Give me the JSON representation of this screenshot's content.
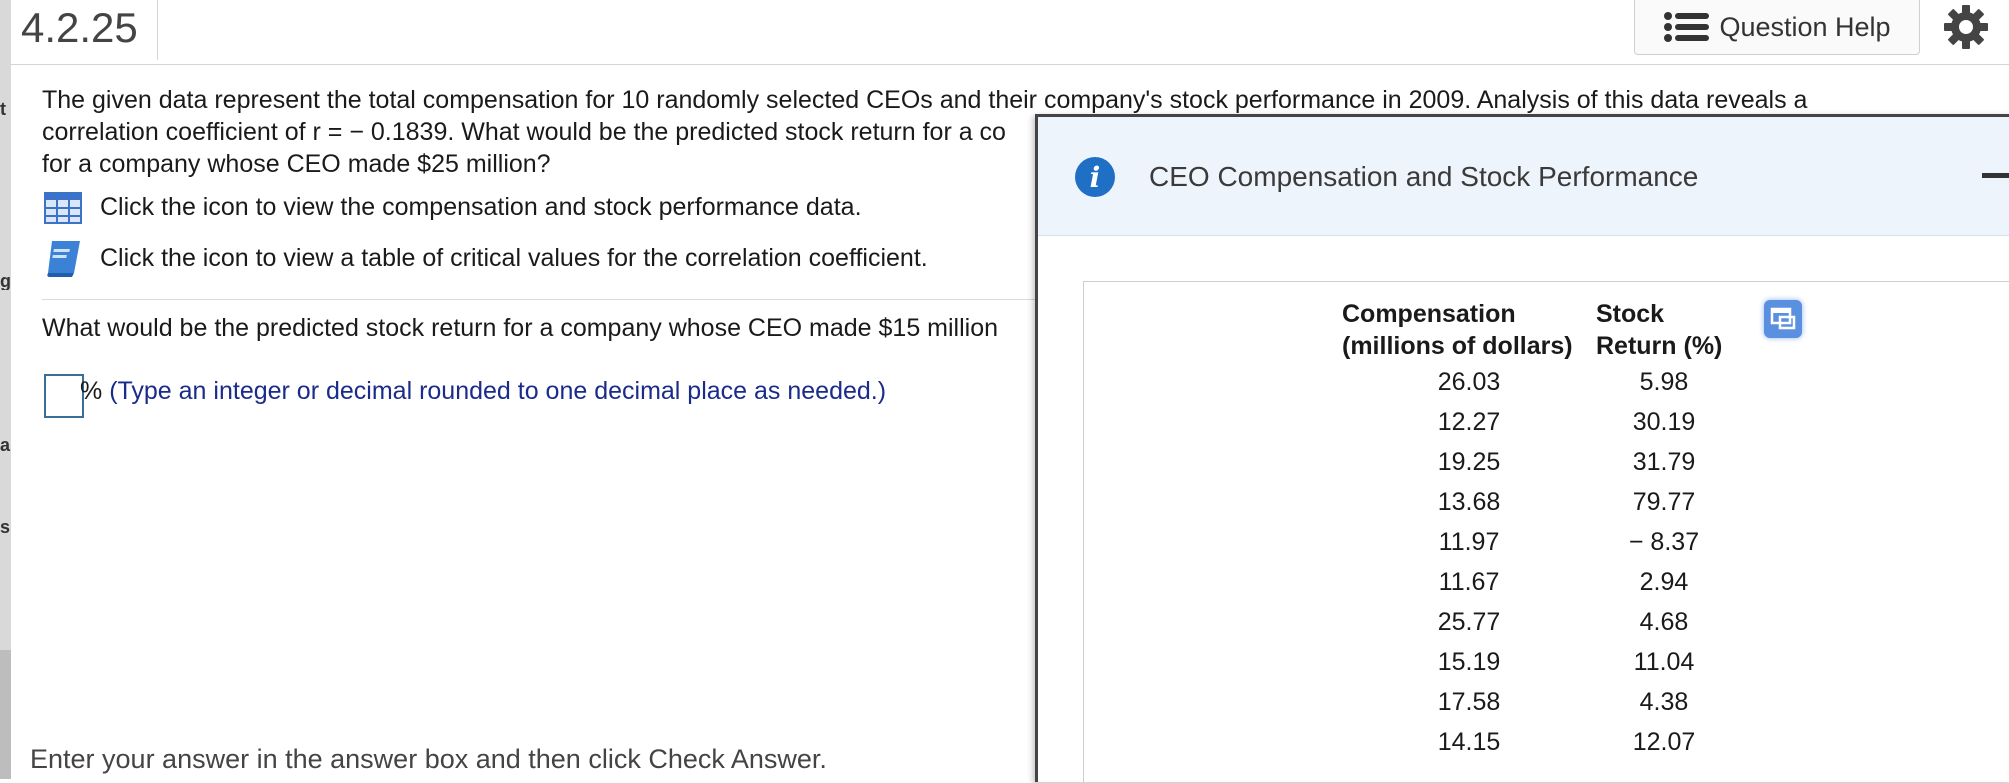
{
  "header": {
    "question_number": "4.2.25",
    "help_label": "Question Help"
  },
  "question": {
    "line1": "The given data represent the total compensation for 10 randomly selected CEOs and their company's stock performance in 2009. Analysis of this data reveals a",
    "line2": "correlation coefficient of r = − 0.1839. What would be the predicted stock return for a co",
    "line3": "for a company whose CEO made $25 million?",
    "data_link_text": "Click the icon to view the compensation and stock performance data.",
    "critical_link_text": "Click the icon to view a table of critical values for the correlation coefficient.",
    "sub_question": "What would be the predicted stock return for a company whose CEO made $15 million",
    "answer_value": "",
    "percent_sign": "%",
    "answer_hint": "(Type an integer or decimal rounded to one decimal place as needed.)",
    "footer": "Enter your answer in the answer box and then click Check Answer."
  },
  "popup": {
    "title": "CEO Compensation and Stock Performance",
    "col1_header_line1": "Compensation",
    "col1_header_line2": "(millions of dollars)",
    "col2_header_line1": "Stock",
    "col2_header_line2": "Return (%)",
    "rows": [
      {
        "comp": "26.03",
        "ret": "5.98"
      },
      {
        "comp": "12.27",
        "ret": "30.19"
      },
      {
        "comp": "19.25",
        "ret": "31.79"
      },
      {
        "comp": "13.68",
        "ret": "79.77"
      },
      {
        "comp": "11.97",
        "ret": "− 8.37"
      },
      {
        "comp": "11.67",
        "ret": "2.94"
      },
      {
        "comp": "25.77",
        "ret": "4.68"
      },
      {
        "comp": "15.19",
        "ret": "11.04"
      },
      {
        "comp": "17.58",
        "ret": "4.38"
      },
      {
        "comp": "14.15",
        "ret": "12.07"
      }
    ]
  },
  "gutter_glyphs": [
    "t",
    "g",
    "a",
    "s"
  ],
  "colors": {
    "accent_blue": "#1f6fc4",
    "hint_text": "#1b2b8a",
    "popup_header_bg": "#eef4fb"
  },
  "icons": [
    "list-icon",
    "gear-icon",
    "table-grid-icon",
    "book-icon",
    "info-icon",
    "minimize-icon",
    "copy-icon"
  ]
}
